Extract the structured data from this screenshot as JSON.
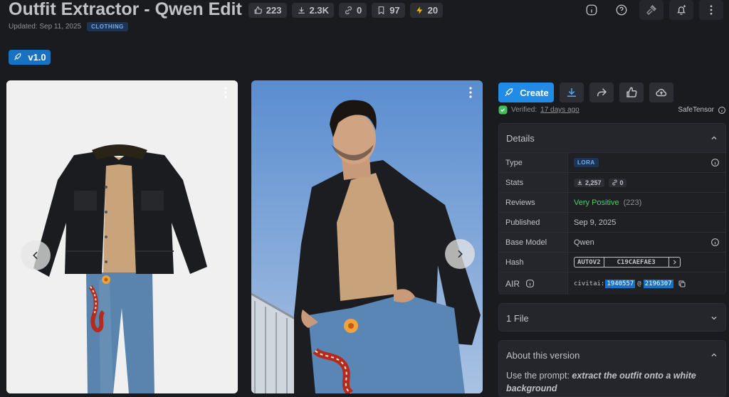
{
  "header": {
    "title": "Outfit Extractor - Qwen Edit",
    "stats": {
      "likes": "223",
      "downloads": "2.3K",
      "links": "0",
      "bookmarks": "97",
      "tips": "20"
    },
    "updated": "Updated: Sep 11, 2025",
    "category": "CLOTHING"
  },
  "version": {
    "label": "v1.0"
  },
  "actions": {
    "create_label": "Create"
  },
  "verification": {
    "label": "Verified:",
    "ago": "17 days ago",
    "safetensor": "SafeTensor"
  },
  "details": {
    "heading": "Details",
    "rows": {
      "type_label": "Type",
      "type_value": "LORA",
      "stats_label": "Stats",
      "stats_downloads": "2,257",
      "stats_links": "0",
      "reviews_label": "Reviews",
      "reviews_value": "Very Positive",
      "reviews_count": "(223)",
      "published_label": "Published",
      "published_value": "Sep 9, 2025",
      "base_label": "Base Model",
      "base_value": "Qwen",
      "hash_label": "Hash",
      "hash_type": "AUTOV2",
      "hash_value": "C19CAEFAE3",
      "air_label": "AIR",
      "air_prefix": "civitai:",
      "air_model": "1940557",
      "air_sep": "@",
      "air_version": "2196307"
    }
  },
  "files": {
    "heading": "1 File"
  },
  "about": {
    "heading": "About this version",
    "prefix": "Use the prompt: ",
    "prompt": "extract the outfit onto a white background"
  },
  "colors": {
    "accent": "#228be6",
    "background": "#1a1b1e",
    "panel": "#25262b",
    "positive": "#51cf66"
  }
}
